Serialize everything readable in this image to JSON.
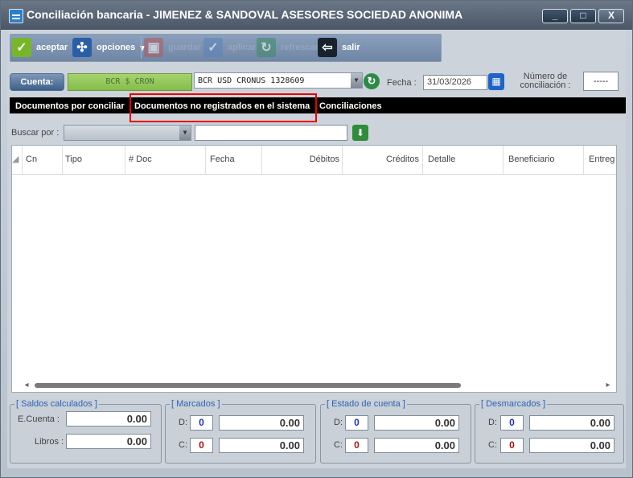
{
  "window": {
    "title": "Conciliación bancaria - JIMENEZ & SANDOVAL ASESORES SOCIEDAD ANONIMA",
    "controls": [
      "_",
      "□",
      "X"
    ]
  },
  "toolbar": {
    "aceptar": "aceptar",
    "opciones": "opciones",
    "guardar": "guardar",
    "aplicar": "aplicar",
    "refrescar": "refrescar",
    "salir": "salir"
  },
  "account": {
    "button": "Cuenta:",
    "green_value": "BCR $ CRON",
    "selected": "BCR USD CRONUS 1328609",
    "fecha_label": "Fecha :",
    "fecha": "31/03/2026",
    "num_label": "Número de conciliación :",
    "num_value": "-----"
  },
  "tabs": [
    "Documentos por conciliar",
    "Documentos no registrados en el sistema",
    "Conciliaciones"
  ],
  "search": {
    "label": "Buscar por :"
  },
  "table": {
    "columns": [
      "Cn",
      "Tipo",
      "# Doc",
      "Fecha",
      "Débitos",
      "Créditos",
      "Detalle",
      "Beneficiario",
      "Entreg"
    ]
  },
  "saldos": {
    "title": "[ Saldos calculados ]",
    "ecuenta_label": "E.Cuenta :",
    "ecuenta": "0.00",
    "libros_label": "Libros :",
    "libros": "0.00"
  },
  "marcados": {
    "title": "[ Marcados ]",
    "d": "0",
    "dval": "0.00",
    "c": "0",
    "cval": "0.00"
  },
  "estado": {
    "title": "[ Estado de cuenta ]",
    "d": "0",
    "dval": "0.00",
    "c": "0",
    "cval": "0.00"
  },
  "desmarcados": {
    "title": "[ Desmarcados ]",
    "d": "0",
    "dval": "0.00",
    "c": "0",
    "cval": "0.00"
  },
  "colors": {
    "accent": "#4b5766",
    "highlight": "#ee0000",
    "green": "#84bd4a"
  }
}
